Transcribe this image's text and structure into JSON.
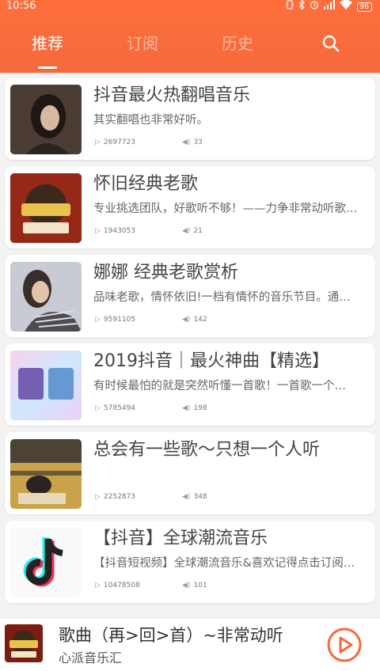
{
  "status_bar": {
    "time": "10:56",
    "icons": [
      "vibrate-icon",
      "bluetooth-icon",
      "alarm-icon",
      "signal-icon",
      "wifi-icon",
      "battery-icon"
    ],
    "battery": "96"
  },
  "header": {
    "tabs": [
      {
        "label": "推荐",
        "active": true
      },
      {
        "label": "订阅",
        "active": false
      },
      {
        "label": "历史",
        "active": false
      }
    ],
    "search_icon": "search-icon",
    "accent_color": "#f5693b"
  },
  "playlists": [
    {
      "title": "抖音最火热翻唱音乐",
      "desc": "其实翻唱也非常好听。",
      "plays": "2697723",
      "tracks": "33",
      "cover": "woman-portrait"
    },
    {
      "title": "怀旧经典老歌",
      "desc": "专业挑选团队，好歌听不够！——力争非常动听歌…",
      "plays": "1943053",
      "tracks": "21",
      "cover": "classic-badge"
    },
    {
      "title": "娜娜 经典老歌赏析",
      "desc": "品味老歌，情怀依旧!一档有情怀的音乐节目。通…",
      "plays": "9591105",
      "tracks": "142",
      "cover": "woman-portrait-2"
    },
    {
      "title": "2019抖音｜最火神曲【精选】",
      "desc": "有时候最怕的就是突然听懂一首歌！一首歌一个…",
      "plays": "5785494",
      "tracks": "198",
      "cover": "douyin-text"
    },
    {
      "title": "总会有一些歌～只想一个人听",
      "desc": "",
      "plays": "2252873",
      "tracks": "348",
      "cover": "person-sitting"
    },
    {
      "title": "【抖音】全球潮流音乐",
      "desc": "【抖音短视频】全球潮流音乐&喜欢记得点击订阅…",
      "plays": "10478508",
      "tracks": "101",
      "cover": "tiktok-logo"
    }
  ],
  "player": {
    "song": "歌曲（再>回>首）~非常动听",
    "artist": "心派音乐汇",
    "play_icon": "play-icon"
  }
}
